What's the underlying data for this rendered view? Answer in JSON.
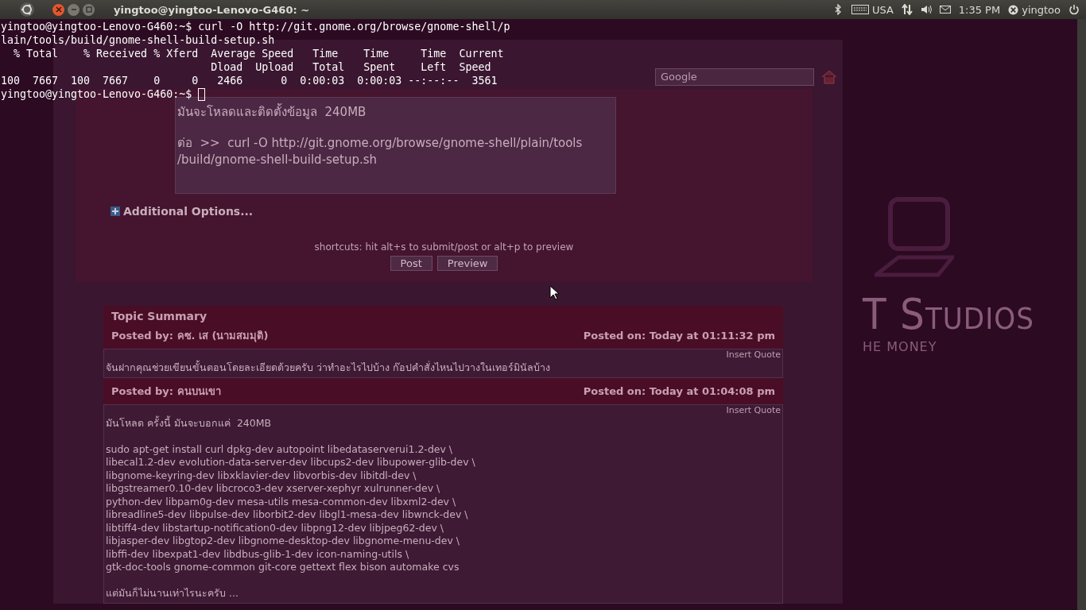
{
  "top_panel": {
    "window_title": "yingtoo@yingtoo-Lenovo-G460: ~",
    "keyboard_layout": "USA",
    "clock": "1:35 PM",
    "user": "yingtoo"
  },
  "browser": {
    "search_placeholder": "Google",
    "reply_box": {
      "paragraphs": [
        [
          "มันจะโหลดและติดตั้งข้อมูล  240MB"
        ],
        [
          "ต่อ  >>  curl -O http://git.gnome.org/browse/gnome-shell/plain/tools",
          "/build/gnome-shell-build-setup.sh"
        ]
      ]
    },
    "additional_options": "Additional Options...",
    "shortcuts_hint": "shortcuts: hit alt+s to submit/post or alt+p to preview",
    "buttons": [
      "Post",
      "Preview"
    ],
    "topic_summary": {
      "title": "Topic Summary",
      "posts": [
        {
          "author": "Posted by: คซ. เส (นามสมมุติ)",
          "date": "Posted on: Today at 01:11:32 pm",
          "insert_quote": "Insert Quote",
          "paragraphs": [
            [
              "จันฝากคุณช่วยเขียนขั้นตอนโดยละเอียดด้วยครับ ว่าทำอะไรไปบ้าง ก๊อปคำสั่งไหนไปวางในเทอร์มินัลบ้าง"
            ]
          ]
        },
        {
          "author": "Posted by: คนบนเขา",
          "date": "Posted on: Today at 01:04:08 pm",
          "insert_quote": "Insert Quote",
          "paragraphs": [
            [
              "มันโหลด ครั้งนี้ มันจะบอกแค่  240MB"
            ],
            [
              "sudo apt-get install curl dpkg-dev autopoint libedataserverui1.2-dev \\",
              "libecal1.2-dev evolution-data-server-dev libcups2-dev libupower-glib-dev \\",
              "libgnome-keyring-dev libxklavier-dev libvorbis-dev libitdl-dev \\",
              "libgstreamer0.10-dev libcroco3-dev xserver-xephyr xulrunner-dev \\",
              "python-dev libpam0g-dev mesa-utils mesa-common-dev libxml2-dev \\",
              "libreadline5-dev libpulse-dev liborbit2-dev libgl1-mesa-dev libwnck-dev \\",
              "libtiff4-dev libstartup-notification0-dev libpng12-dev libjpeg62-dev \\",
              "libjasper-dev libgtop2-dev libgnome-desktop-dev libgnome-menu-dev \\",
              "libffi-dev libexpat1-dev libdbus-glib-1-dev icon-naming-utils \\",
              "gtk-doc-tools gnome-common git-core gettext flex bison automake cvs"
            ],
            [
              "แต่มันก็ไม่นานเท่าไรนะครับ ..."
            ]
          ]
        }
      ]
    }
  },
  "wallpaper": {
    "brand": "T Studios",
    "tagline": "HE MONEY"
  },
  "terminal": {
    "lines": [
      "yingtoo@yingtoo-Lenovo-G460:~$ curl -O http://git.gnome.org/browse/gnome-shell/p",
      "lain/tools/build/gnome-shell-build-setup.sh",
      "  % Total    % Received % Xferd  Average Speed   Time    Time     Time  Current",
      "                                 Dload  Upload   Total   Spent    Left  Speed",
      "100  7667  100  7667    0     0   2466      0  0:00:03  0:00:03 --:--:--  3561"
    ],
    "prompt": "yingtoo@yingtoo-Lenovo-G460:~$ "
  }
}
